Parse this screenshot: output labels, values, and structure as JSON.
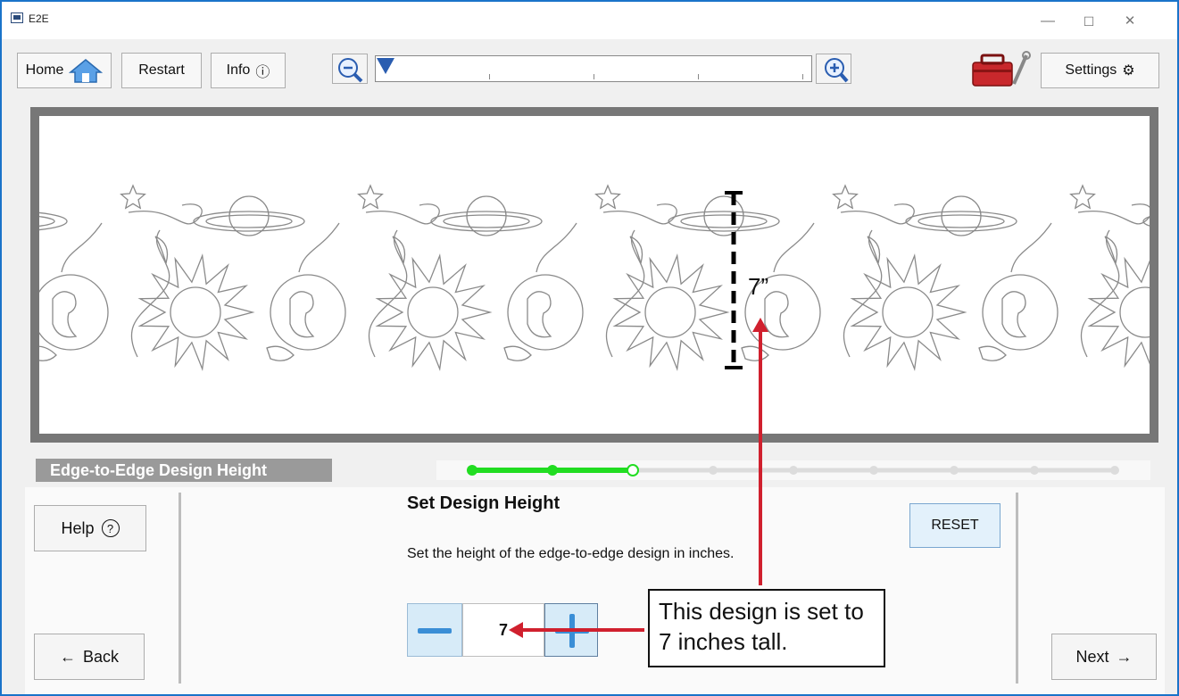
{
  "window": {
    "title": "E2E",
    "minimize": "—",
    "maximize": "☐",
    "close": "✕"
  },
  "toolbar": {
    "home_label": "Home",
    "restart_label": "Restart",
    "info_label": "Info",
    "info_icon": "ⓘ",
    "settings_label": "Settings",
    "settings_icon": "⚙",
    "zoom_level": 0
  },
  "canvas": {
    "measurement_label": "7”"
  },
  "stage": {
    "title": "Edge-to-Edge Design Height",
    "steps_total": 9,
    "steps_completed": 2,
    "current_step": 3
  },
  "panel": {
    "help_label": "Help",
    "help_icon": "?",
    "back_label": "Back",
    "next_label": "Next",
    "heading": "Set Design Height",
    "description": "Set the height of the edge-to-edge design in inches.",
    "reset_label": "RESET",
    "height_value": "7"
  },
  "callout": {
    "text": "This design is set to 7 inches tall."
  },
  "colors": {
    "accent": "#1a73c9",
    "progress": "#22dd22",
    "arrow": "#d0202e"
  }
}
